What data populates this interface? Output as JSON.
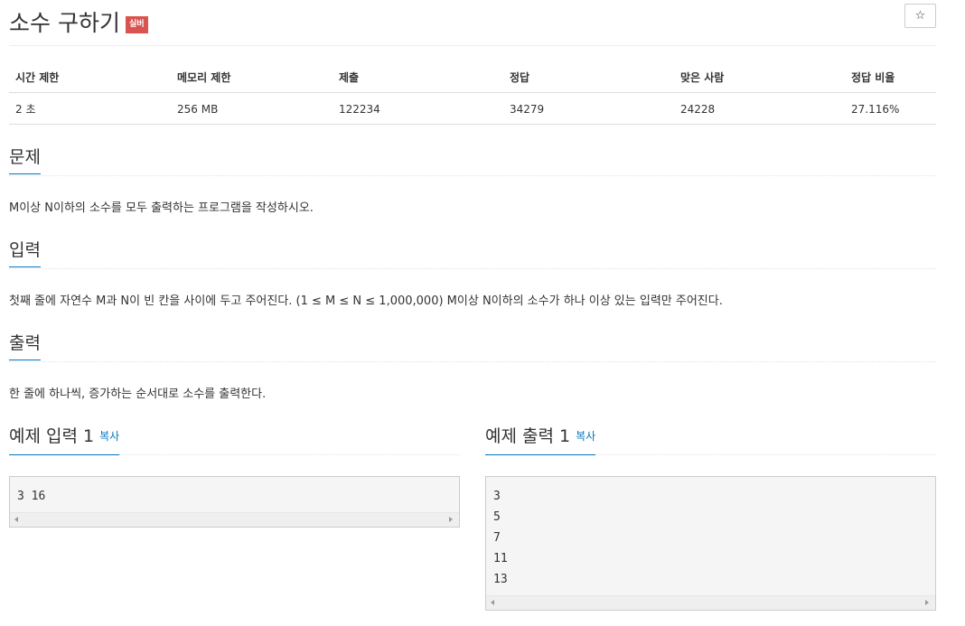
{
  "problem": {
    "title": "소수 구하기",
    "tier_badge": "실버",
    "star_icon": "☆"
  },
  "info_table": {
    "headers": [
      "시간 제한",
      "메모리 제한",
      "제출",
      "정답",
      "맞은 사람",
      "정답 비율"
    ],
    "values": [
      "2 초",
      "256 MB",
      "122234",
      "34279",
      "24228",
      "27.116%"
    ]
  },
  "sections": {
    "problem": {
      "title": "문제",
      "text": "M이상 N이하의 소수를 모두 출력하는 프로그램을 작성하시오."
    },
    "input": {
      "title": "입력",
      "text": "첫째 줄에 자연수 M과 N이 빈 칸을 사이에 두고 주어진다. (1 ≤ M ≤ N ≤ 1,000,000) M이상 N이하의 소수가 하나 이상 있는 입력만 주어진다."
    },
    "output": {
      "title": "출력",
      "text": "한 줄에 하나씩, 증가하는 순서대로 소수를 출력한다."
    }
  },
  "samples": {
    "input": {
      "title": "예제 입력 1",
      "copy_label": "복사",
      "lines": [
        "3 16"
      ]
    },
    "output": {
      "title": "예제 출력 1",
      "copy_label": "복사",
      "lines": [
        "3",
        "5",
        "7",
        "11",
        "13"
      ]
    }
  },
  "colors": {
    "accent": "#0076c0",
    "tier_badge_bg": "#d9534f"
  }
}
